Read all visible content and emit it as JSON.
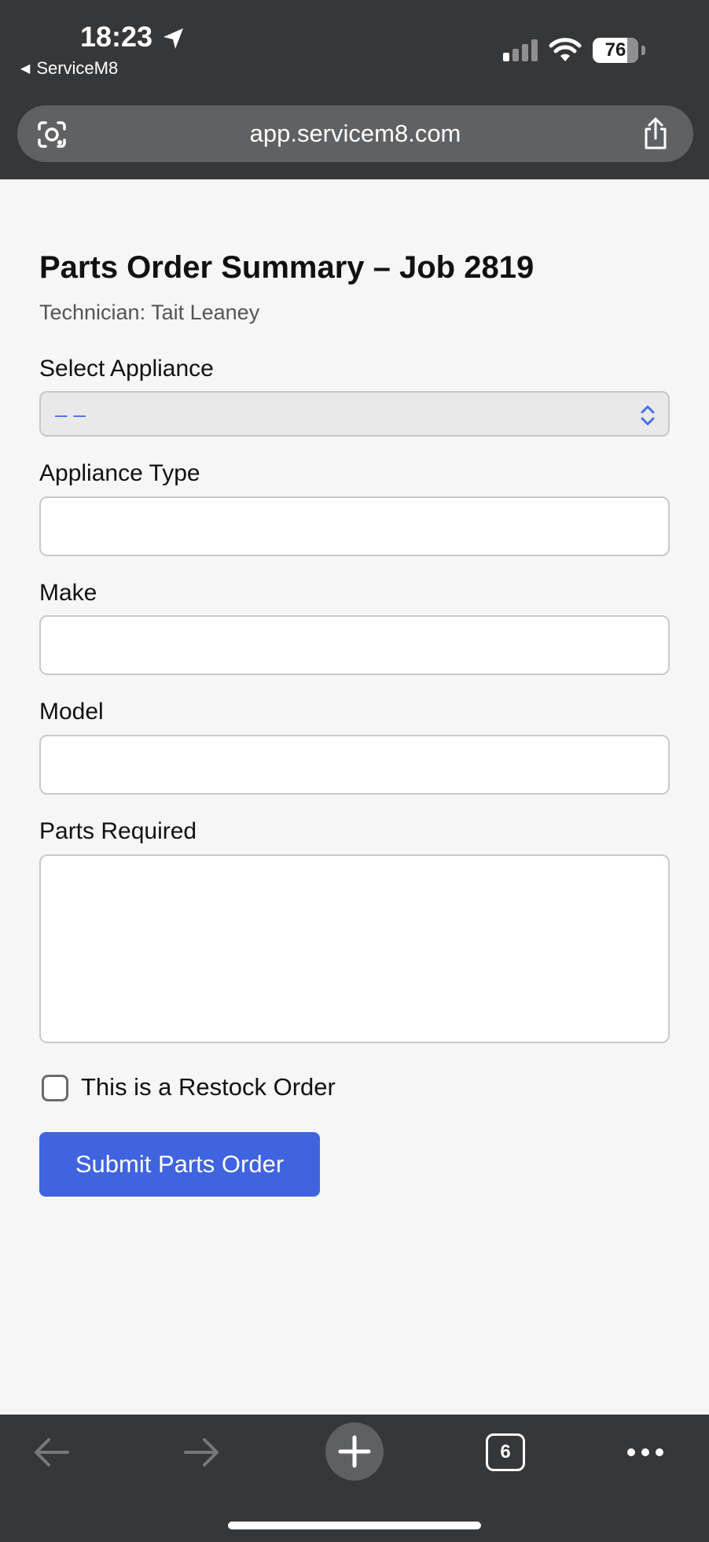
{
  "status_bar": {
    "time": "18:23",
    "back_app": "ServiceM8",
    "battery": "76"
  },
  "browser": {
    "url": "app.servicem8.com",
    "open_tabs": "6"
  },
  "form": {
    "title": "Parts Order Summary – Job 2819",
    "technician": "Technician: Tait Leaney",
    "select_appliance_label": "Select Appliance",
    "select_appliance_value": "– –",
    "appliance_type_label": "Appliance Type",
    "make_label": "Make",
    "model_label": "Model",
    "parts_required_label": "Parts Required",
    "restock_label": "This is a Restock Order",
    "submit_label": "Submit Parts Order"
  },
  "colors": {
    "chrome": "#363739",
    "url_bar": "#5f6163",
    "accent": "#4063e0",
    "page_bg": "#f6f6f6"
  }
}
